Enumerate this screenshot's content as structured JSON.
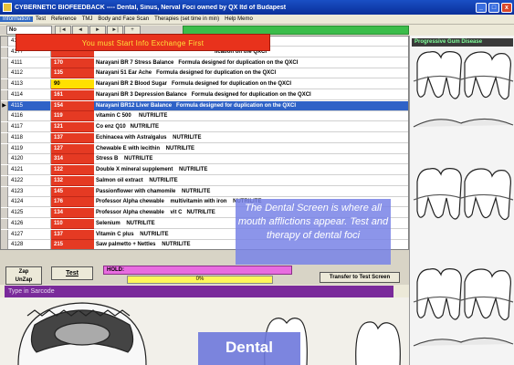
{
  "window": {
    "title": "CYBERNETIC BIOFEEDBACK  ----   Dental, Sinus, Nerval Foci  owned by QX ltd of Budapest",
    "buttons": [
      "_",
      "□",
      "x"
    ]
  },
  "menu": [
    "Information",
    "Test",
    "Reference",
    "TMJ",
    "Body and Face Scan",
    "Therapies (set time in min)",
    "Help Memo"
  ],
  "nav": {
    "col_label": "No",
    "buttons": [
      "|◄",
      "◄",
      "►",
      "►|",
      "+"
    ]
  },
  "banner": "You must Start Info Exchange First",
  "rows": [
    {
      "id": "41??",
      "val": "",
      "desc": "                                                                              lication on the QXCI"
    },
    {
      "id": "41??",
      "val": "",
      "desc": "                                                                              lication on the QXCI"
    },
    {
      "id": "4111",
      "val": "170",
      "desc": "Narayani BR 7 Stress Balance   Formula designed for duplication on the QXCI"
    },
    {
      "id": "4112",
      "val": "135",
      "desc": "Narayani 51 Ear Ache   Formula designed for duplication on the QXCI"
    },
    {
      "id": "4113",
      "val": "90",
      "desc": "Narayani BR 2 Blood Sugar   Formula designed for duplication on the QXCI"
    },
    {
      "id": "4114",
      "val": "161",
      "desc": "Narayani BR 3 Depression Balance   Formula designed for duplication on the QXCI"
    },
    {
      "id": "4115",
      "val": "154",
      "desc": "Narayani BR12 Liver Balance   Formula designed for duplication on the QXCI"
    },
    {
      "id": "4116",
      "val": "119",
      "desc": "vitamin C 500     NUTRILITE"
    },
    {
      "id": "4117",
      "val": "121",
      "desc": "Co enz Q10   NUTRILITE"
    },
    {
      "id": "4118",
      "val": "137",
      "desc": "Echinacea with Astralgalus    NUTRILITE"
    },
    {
      "id": "4119",
      "val": "127",
      "desc": "Chewable E with lecithin    NUTRILITE"
    },
    {
      "id": "4120",
      "val": "314",
      "desc": "Stress B    NUTRILITE"
    },
    {
      "id": "4121",
      "val": "122",
      "desc": "Double X mineral supplement    NUTRILITE"
    },
    {
      "id": "4122",
      "val": "132",
      "desc": "Salmon oil extract    NUTRILITE"
    },
    {
      "id": "4123",
      "val": "145",
      "desc": "Passionflower with chamomile    NUTRILITE"
    },
    {
      "id": "4124",
      "val": "176",
      "desc": "Professor Alpha chewable    multivitamin with iron    NUTRILITE"
    },
    {
      "id": "4125",
      "val": "134",
      "desc": "Professor Alpha chewable    vit C   NUTRILITE"
    },
    {
      "id": "4126",
      "val": "110",
      "desc": "Selenium    NUTRILITE"
    },
    {
      "id": "4127",
      "val": "137",
      "desc": "Vitamin C plus    NUTRILITE"
    },
    {
      "id": "4128",
      "val": "215",
      "desc": "Saw palmetto + Nettles    NUTRILITE"
    }
  ],
  "selected_row": "4115",
  "highlight_row": "4113",
  "right_panel": {
    "label": "Progressive Gum Disease"
  },
  "callout": "The Dental Screen is where all mouth afflictions appear.  Test and therapy of dental foci",
  "controls": {
    "zap_label_1": "Zap",
    "zap_label_2": "UnZap",
    "test_label": "Test",
    "hold_label": "HOLD:",
    "progress_text": "0%",
    "progress_value": 0,
    "transfer_label": "Transfer to Test Screen"
  },
  "sarcode_placeholder": "Type in Sarcode",
  "bottom_label": "Dental",
  "colors": {
    "title_blue": "#1a4fc4",
    "value_red": "#e53a23",
    "select_blue": "#2f62c7",
    "highlight_yellow": "#ffe000",
    "banner_red": "#e8321c",
    "banner_text": "#ffe23a",
    "callout_bg": "#7882e6",
    "sarcode_purple": "#7a2a9a",
    "hold_pink": "#e86ce0",
    "nav_green": "#3bbd4a"
  }
}
